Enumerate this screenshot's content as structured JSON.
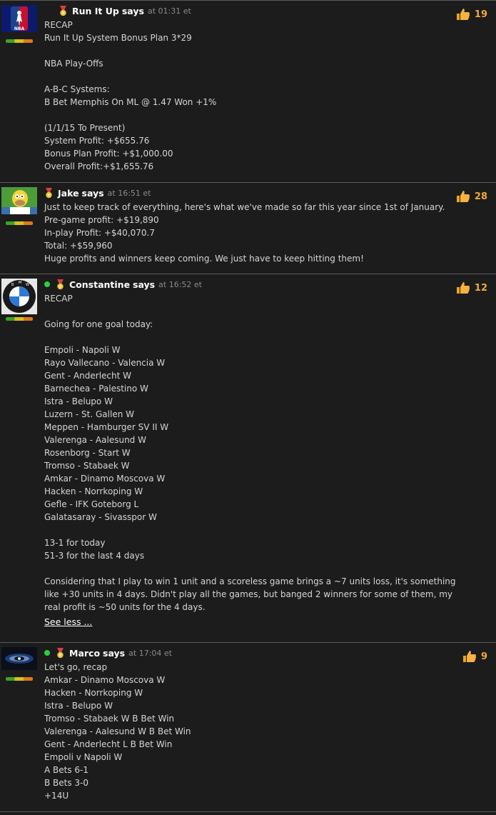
{
  "posts": [
    {
      "author": "Run It Up",
      "says": "says",
      "time": "at 01:31 et",
      "likes": "19",
      "online": false,
      "avatar": "nba-logo-icon",
      "lines": [
        "RECAP",
        "Run It Up System Bonus Plan 3*29",
        "",
        "NBA Play-Offs",
        "",
        "A-B-C Systems:",
        "B Bet Memphis On ML @ 1.47 Won +1%",
        "",
        "(1/1/15 To Present)",
        "System Profit: +$655.76",
        "Bonus Plan Profit: +$1,000.00",
        "Overall Profit:+$1,655.76"
      ]
    },
    {
      "author": "Jake",
      "says": "says",
      "time": "at 16:51 et",
      "likes": "28",
      "online": false,
      "avatar": "homer-cartoon-icon",
      "lines": [
        "Just to keep track of everything, here's what we've made so far this year since 1st of January.",
        "Pre-game profit: +$19,890",
        "In-play Profit: +$40,070.7",
        "Total: +$59,960",
        "Huge profits and winners keep coming. We just have to keep hitting them!"
      ]
    },
    {
      "author": "Constantine",
      "says": "says",
      "time": "at 16:52 et",
      "likes": "12",
      "online": true,
      "avatar": "bmw-logo-icon",
      "lines": [
        "RECAP",
        "",
        "Going for one goal today:",
        "",
        "Empoli - Napoli W",
        "Rayo Vallecano - Valencia W",
        "Gent - Anderlecht W",
        "Barnechea - Palestino W",
        "Istra - Belupo W",
        "Luzern - St. Gallen W",
        "Meppen - Hamburger SV II W",
        "Valerenga - Aalesund W",
        "Rosenborg - Start W",
        "Tromso - Stabaek W",
        "Amkar - Dinamo Moscova W",
        "Hacken - Norrkoping W",
        "Gefle - IFK Goteborg L",
        "Galatasaray - Sivasspor W",
        "",
        "13-1 for today",
        "51-3 for the last 4 days",
        "",
        "Considering that I play to win 1 unit and a scoreless game brings a ~7 units loss, it's something",
        "like +30 units in 4 days. Didn't play all the games, but banged 2 winners for some of them, my",
        "real profit is ~50 units for the 4 days."
      ],
      "see_less": "See less ..."
    },
    {
      "author": "Marco",
      "says": "says",
      "time": "at 17:04 et",
      "likes": "9",
      "online": true,
      "avatar": "galaxy-eye-icon",
      "lines": [
        "Let's go, recap",
        "Amkar - Dinamo Moscova W",
        "Hacken - Norrkoping W",
        "Istra - Belupo W",
        "Tromso - Stabaek W B Bet Win",
        "Valerenga - Aalesund W B Bet Win",
        "Gent - Anderlecht L B Bet Win",
        "Empoli v Napoli W",
        "A Bets 6-1",
        "B Bets 3-0",
        "+14U"
      ]
    }
  ],
  "colors": {
    "background": "#1c1c1c",
    "author": "#ffffff",
    "timestamp": "#8a8a8a",
    "likes": "#f3a93a",
    "online": "#2fcf3a"
  }
}
